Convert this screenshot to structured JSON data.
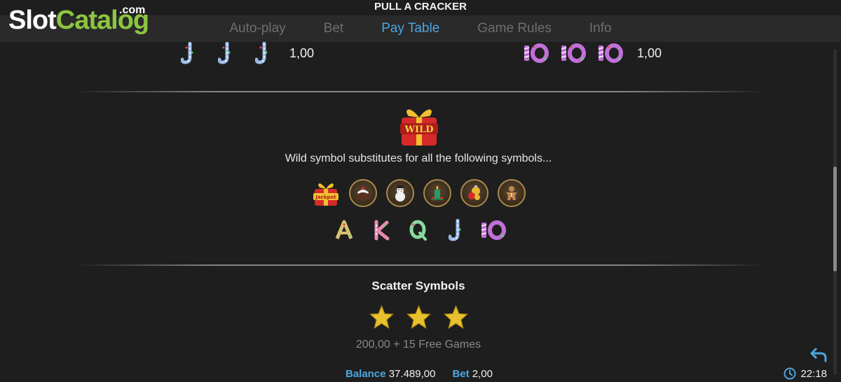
{
  "watermark": {
    "slot": "Slot",
    "catalog": "Catalog",
    "com": ".com"
  },
  "header": {
    "title": "PULL A CRACKER"
  },
  "tabs": [
    {
      "label": "Auto-play",
      "active": false
    },
    {
      "label": "Bet",
      "active": false
    },
    {
      "label": "Pay Table",
      "active": true
    },
    {
      "label": "Game Rules",
      "active": false
    },
    {
      "label": "Info",
      "active": false
    }
  ],
  "paytable": {
    "left_row": {
      "symbols": [
        "j-icon",
        "j-icon",
        "j-icon"
      ],
      "value": "1,00"
    },
    "right_row": {
      "symbols": [
        "ten-icon",
        "ten-icon",
        "ten-icon"
      ],
      "value": "1,00"
    }
  },
  "wild": {
    "icon": "wild-gift-icon",
    "badge": "WILD",
    "description": "Wild symbol substitutes for all the following symbols...",
    "premium_symbols": [
      "jackpot-gift-icon",
      "pudding-icon",
      "snowman-icon",
      "candle-icon",
      "ornament-icon",
      "gingerbread-icon"
    ],
    "jackpot_label": "Jackpot",
    "letter_symbols": [
      "A",
      "K",
      "Q",
      "J",
      "10"
    ]
  },
  "scatter": {
    "title": "Scatter Symbols",
    "symbols": [
      "star-icon",
      "star-icon",
      "star-icon"
    ],
    "payout": "200,00 + 15 Free Games"
  },
  "status": {
    "balance_label": "Balance",
    "balance_value": "37.489,00",
    "bet_label": "Bet",
    "bet_value": "2,00",
    "time": "22:18"
  },
  "colors": {
    "accent": "#4da6e0",
    "background": "#1e1e1e",
    "tabbar": "#2a2a2a",
    "gold": "#e8c22e",
    "brand_green": "#8cc63f"
  }
}
